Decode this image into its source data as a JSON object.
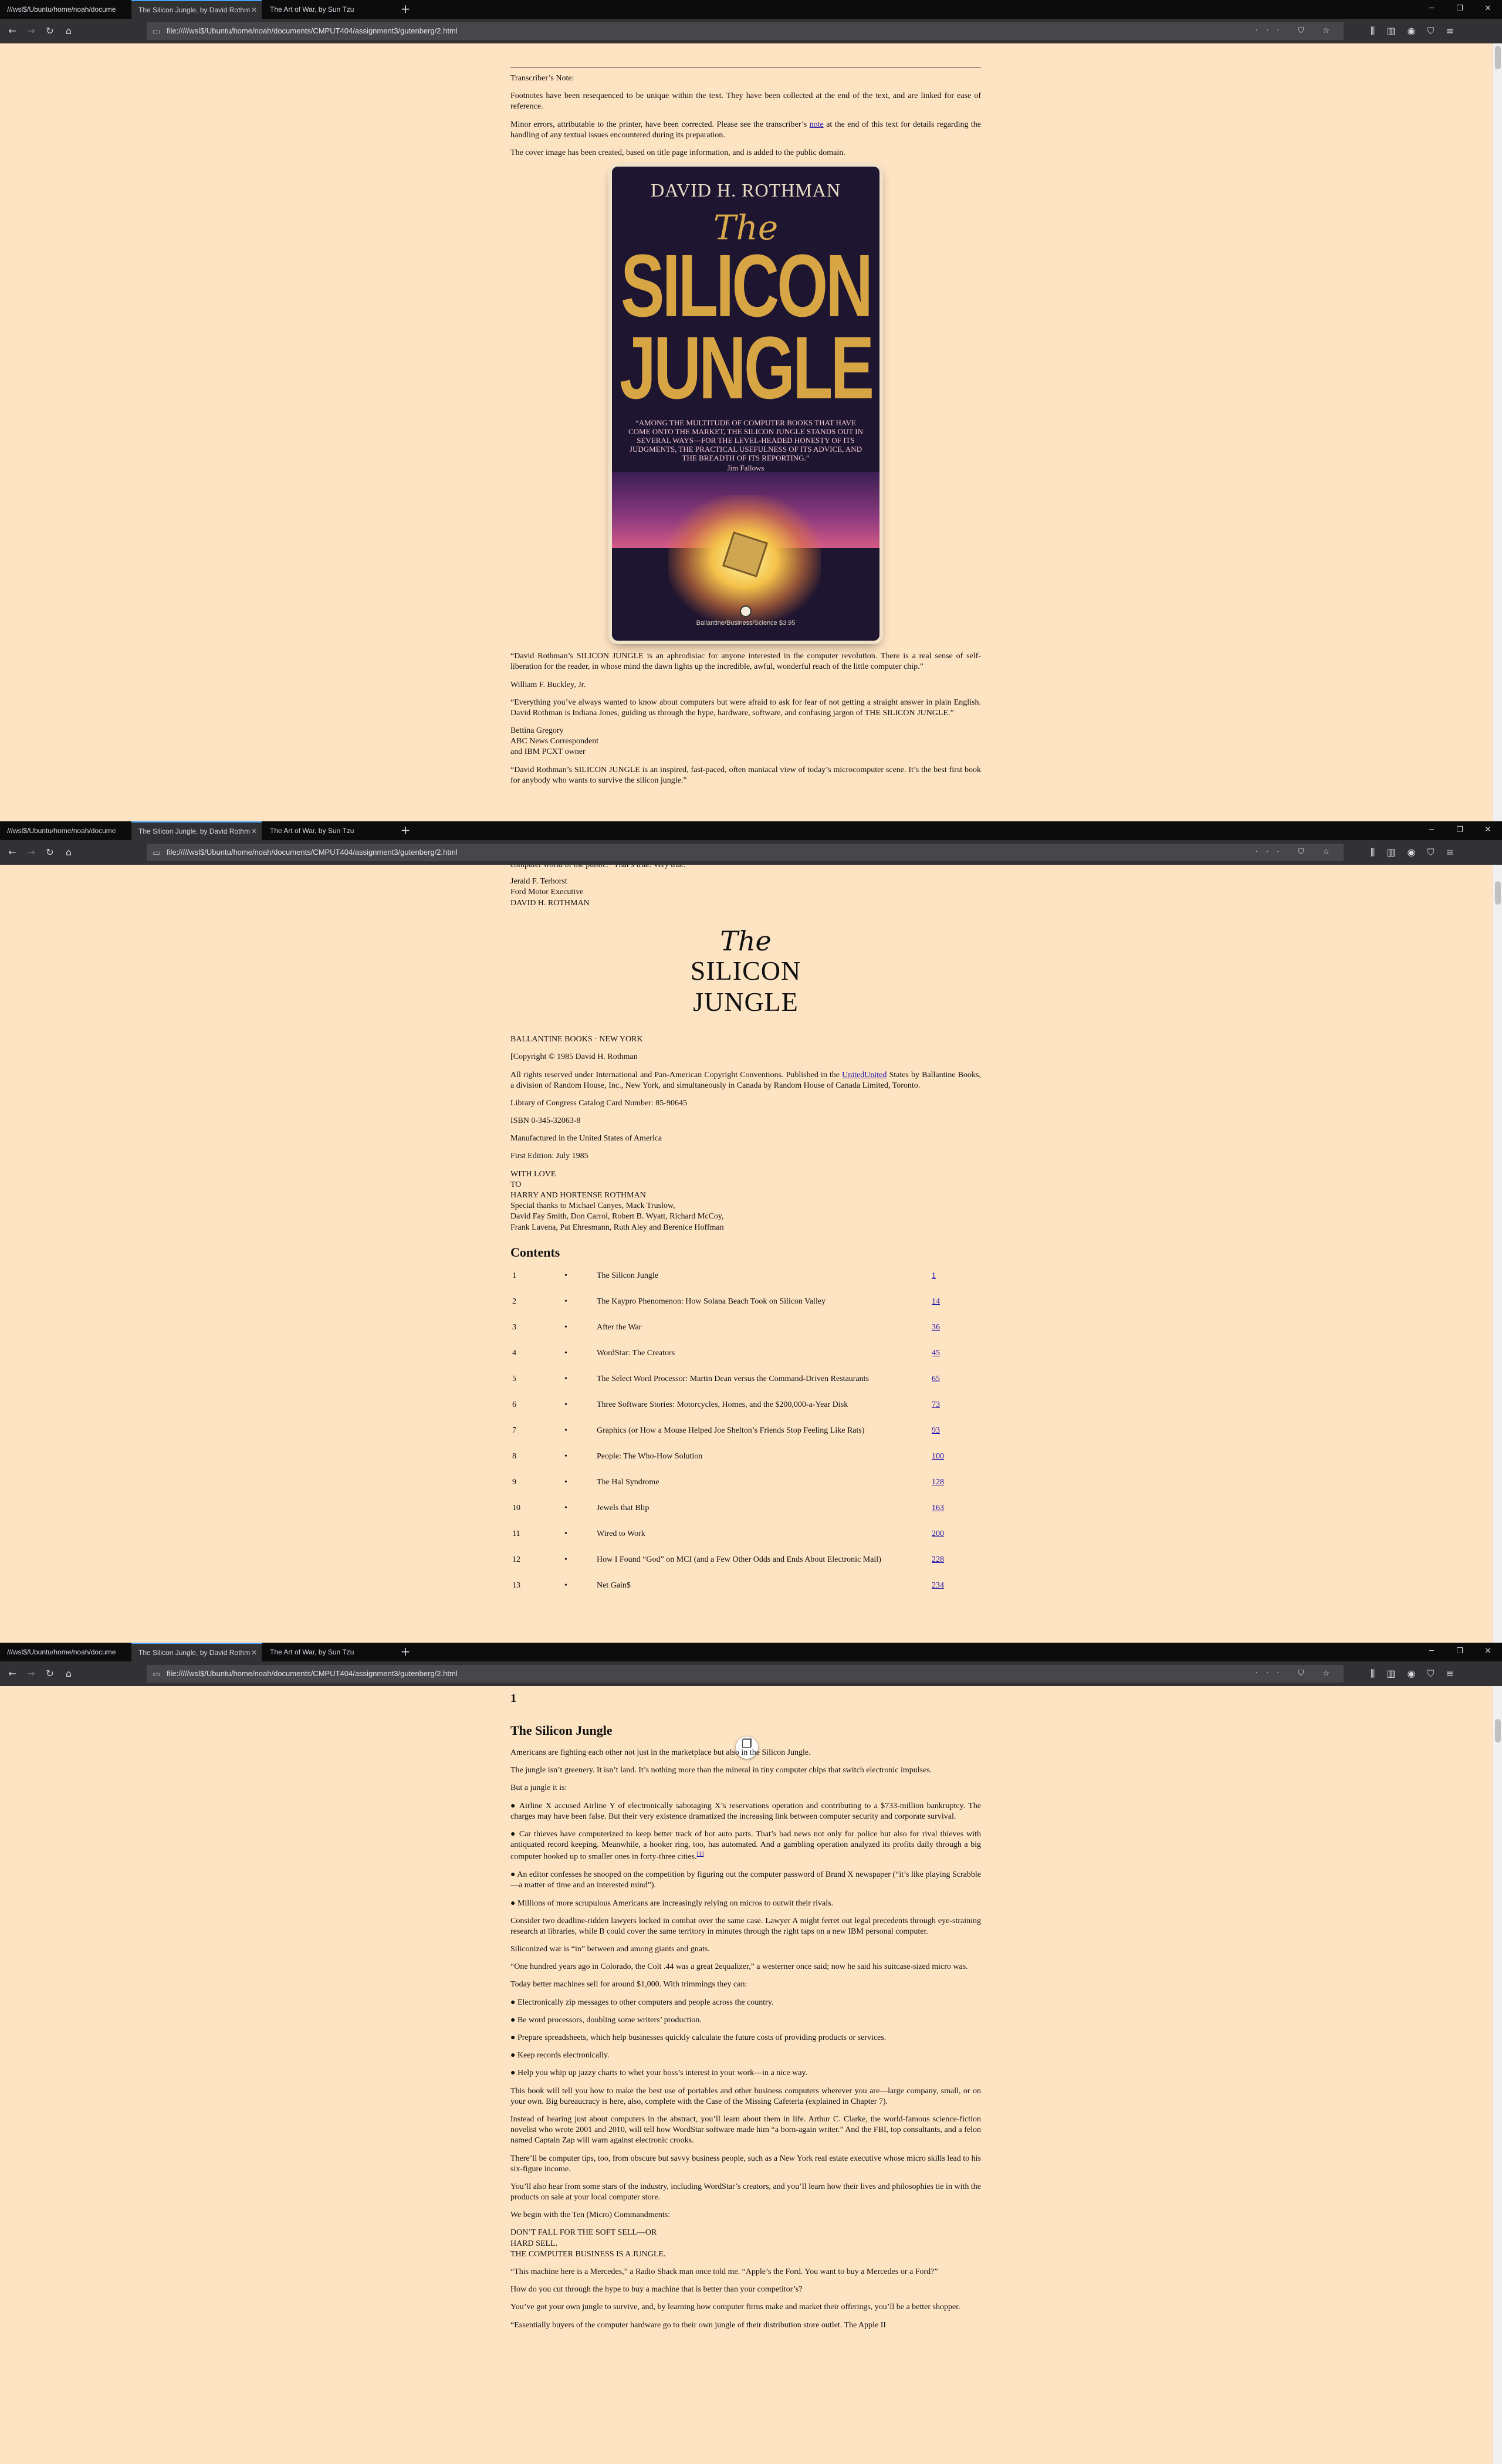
{
  "browser": {
    "tabs": [
      {
        "label": "///wsl$/Ubuntu/home/noah/docume"
      },
      {
        "label": "The Silicon Jungle, by David Rothm"
      },
      {
        "label": "The Art of War, by Sun Tzu"
      }
    ],
    "new_tab_label": "+",
    "url": "file://///wsl$/Ubuntu/home/noah/documents/CMPUT404/assignment3/gutenberg/2.html",
    "url_actions": "··· ⛉ ☆"
  },
  "win1": {
    "transcriber_label": "Transcriber’s Note:",
    "note_p1": "Footnotes have been resequenced to be unique within the text. They have been collected at the end of the text, and are linked for ease of reference.",
    "note_p2_before": "Minor errors, attributable to the printer, have been corrected. Please see the transcriber’s ",
    "note_p2_link": "note",
    "note_p2_after": " at the end of this text for details regarding the handling of any textual issues encountered during its preparation.",
    "note_p3": "The cover image has been created, based on title page information, and is added to the public domain.",
    "cover": {
      "author": "DAVID H. ROTHMAN",
      "the": "The",
      "silicon": "SILICON",
      "jungle": "JUNGLE",
      "quote": "“AMONG THE MULTITUDE OF COMPUTER BOOKS THAT HAVE COME ONTO THE MARKET, THE SILICON JUNGLE STANDS OUT IN SEVERAL WAYS—FOR THE LEVEL-HEADED HONESTY OF ITS JUDGMENTS, THE PRACTICAL USEFULNESS OF ITS ADVICE, AND THE BREADTH OF ITS REPORTING.”",
      "quote_source": "Jim Fallows",
      "publisher": "Ballantine/Business/Science $3.95"
    },
    "blurb1": "“David Rothman’s SILICON JUNGLE is an aphrodisiac for anyone interested in the computer revolution. There is a real sense of self-liberation for the reader, in whose mind the dawn lights up the incredible, awful, wonderful reach of the little computer chip.”",
    "blurb1_by": "William F. Buckley, Jr.",
    "blurb2": "“Everything you’ve always wanted to know about computers but were afraid to ask for fear of not getting a straight answer in plain English. David Rothman is Indiana Jones, guiding us through the hype, hardware, software, and confusing jargon of THE SILICON JUNGLE.”",
    "blurb2_by_1": "Bettina Gregory",
    "blurb2_by_2": "ABC News Correspondent",
    "blurb2_by_3": "and IBM PCXT owner",
    "blurb3": "“David Rothman’s SILICON JUNGLE is an inspired, fast-paced, often maniacal view of today’s microcomputer scene. It’s the best first book for anybody who wants to survive the silicon jungle.”"
  },
  "win2": {
    "top_cut": "computer world of the public.” That’s true. Very true.",
    "sig1": "Jerald F. Terhorst",
    "sig2": "Ford Motor Executive",
    "sig3": "DAVID H. ROTHMAN",
    "title_the": "The",
    "title_silicon": "SILICON",
    "title_jungle": "JUNGLE",
    "publisher": "BALLANTINE BOOKS · NEW YORK",
    "copyright": "[Copyright © 1985 David H. Rothman",
    "rights_before": "All rights reserved under International and Pan-American Copyright Conventions. Published in the ",
    "rights_link1": "United",
    "rights_link2": "United",
    "rights_after": " States by Ballantine Books, a division of Random House, Inc., New York, and simultaneously in Canada by Random House of Canada Limited, Toronto.",
    "lccn": "Library of Congress Catalog Card Number: 85-90645",
    "isbn": "ISBN 0-345-32063-8",
    "manufactured": "Manufactured in the United States of America",
    "edition": "First Edition: July 1985",
    "ded1": "WITH LOVE",
    "ded2": "TO",
    "ded3": "HARRY AND HORTENSE ROTHMAN",
    "ded4": "Special thanks to Michael Canyes, Mack Truslow,",
    "ded5": "David Fay Smith, Don Carrol, Robert B. Wyatt, Richard McCoy,",
    "ded6": "Frank Lavena, Pat Ehresmann, Ruth Aley and Berenice Hoffman",
    "contents_heading": "Contents",
    "toc": [
      {
        "num": "1",
        "dot": "•",
        "title": "The Silicon Jungle",
        "page": "1"
      },
      {
        "num": "2",
        "dot": "•",
        "title": "The Kaypro Phenomenon: How Solana Beach Took on Silicon Valley",
        "page": "14"
      },
      {
        "num": "3",
        "dot": "•",
        "title": "After the War",
        "page": "36"
      },
      {
        "num": "4",
        "dot": "•",
        "title": "WordStar: The Creators",
        "page": "45"
      },
      {
        "num": "5",
        "dot": "•",
        "title": "The Select Word Processor: Martin Dean versus the Command-Driven Restaurants",
        "page": "65"
      },
      {
        "num": "6",
        "dot": "•",
        "title": "Three Software Stories: Motorcycles, Homes, and the $200,000-a-Year Disk",
        "page": "73"
      },
      {
        "num": "7",
        "dot": "•",
        "title": "Graphics (or How a Mouse Helped Joe Shelton’s Friends Stop Feeling Like Rats)",
        "page": "93"
      },
      {
        "num": "8",
        "dot": "•",
        "title": "People: The Who-How Solution",
        "page": "100"
      },
      {
        "num": "9",
        "dot": "•",
        "title": "The Hal Syndrome",
        "page": "128"
      },
      {
        "num": "10",
        "dot": "•",
        "title": "Jewels that Blip",
        "page": "163"
      },
      {
        "num": "11",
        "dot": "•",
        "title": "Wired to Work",
        "page": "200"
      },
      {
        "num": "12",
        "dot": "•",
        "title": "How I Found “God” on MCI (and a Few Other Odds and Ends About Electronic Mail)",
        "page": "228"
      },
      {
        "num": "13",
        "dot": "•",
        "title": "Net Gain$",
        "page": "234"
      }
    ]
  },
  "win3": {
    "chapnum": "1",
    "chaptitle": "The Silicon Jungle",
    "p1": "Americans are fighting each other not just in the marketplace but also in the Silicon Jungle.",
    "p2": "The jungle isn’t greenery. It isn’t land. It’s nothing more than the mineral in tiny computer chips that switch electronic impulses.",
    "p3": "But a jungle it is:",
    "b1": "● Airline X accused Airline Y of electronically sabotaging X’s reservations operation and contributing to a $733-million bankruptcy. The charges may have been false. But their very existence dramatized the increasing link between computer security and corporate survival.",
    "b2": "● Car thieves have computerized to keep better track of hot auto parts. That’s bad news not only for police but also for rival thieves with antiquated record keeping. Meanwhile, a hooker ring, too, has automated. And a gambling operation analyzed its profits daily through a big computer hooked up to smaller ones in forty-three cities.",
    "b2_sup": "[1]",
    "b3": "● An editor confesses he snooped on the competition by figuring out the computer password of Brand X newspaper (“it’s like playing Scrabble—a matter of time and an interested mind”).",
    "b4": "● Millions of more scrupulous Americans are increasingly relying on micros to outwit their rivals.",
    "p4": "Consider two deadline-ridden lawyers locked in combat over the same case. Lawyer A might ferret out legal precedents through eye-straining research at libraries, while B could cover the same territory in minutes through the right taps on a new IBM personal computer.",
    "p5": "Siliconized war is “in” between and among giants and gnats.",
    "p6": "“One hundred years ago in Colorado, the Colt .44 was a great 2equalizer,” a westerner once said; now he said his suitcase-sized micro was.",
    "p7": "Today better machines sell for around $1,000. With trimmings they can:",
    "c1": "● Electronically zip messages to other computers and people across the country.",
    "c2": "● Be word processors, doubling some writers’ production.",
    "c3": "● Prepare spreadsheets, which help businesses quickly calculate the future costs of providing products or services.",
    "c4": "● Keep records electronically.",
    "c5": "● Help you whip up jazzy charts to whet your boss’s interest in your work—in a nice way.",
    "p8": "This book will tell you how to make the best use of portables and other business computers wherever you are—large company, small, or on your own. Big bureaucracy is here, also, complete with the Case of the Missing Cafeteria (explained in Chapter 7).",
    "p9": "Instead of hearing just about computers in the abstract, you’ll learn about them in life. Arthur C. Clarke, the world-famous science-fiction novelist who wrote 2001 and 2010, will tell how WordStar software made him “a born-again writer.” And the FBI, top consultants, and a felon named Captain Zap will warn against electronic crooks.",
    "p10": "There’ll be computer tips, too, from obscure but savvy business people, such as a New York real estate executive whose micro skills lead to his six-figure income.",
    "p11": "You’ll also hear from some stars of the industry, including WordStar’s creators, and you’ll learn how their lives and philosophies tie in with the products on sale at your local computer store.",
    "p12": "We begin with the Ten (Micro) Commandments:",
    "cmd1": "DON’T FALL FOR THE SOFT SELL—OR",
    "cmd2": "HARD SELL.",
    "cmd3": "THE COMPUTER BUSINESS IS A JUNGLE.",
    "p13": "“This machine here is a Mercedes,” a Radio Shack man once told me. “Apple’s the Ford. You want to buy a Mercedes or a Ford?”",
    "p14": "How do you cut through the hype to buy a machine that is better than your competitor’s?",
    "p15": "You’ve got your own jungle to survive, and, by learning how computer firms make and market their offerings, you’ll be a better shopper.",
    "p16": "“Essentially buyers of the computer hardware go to their own jungle of their distribution store outlet. The Apple II"
  }
}
